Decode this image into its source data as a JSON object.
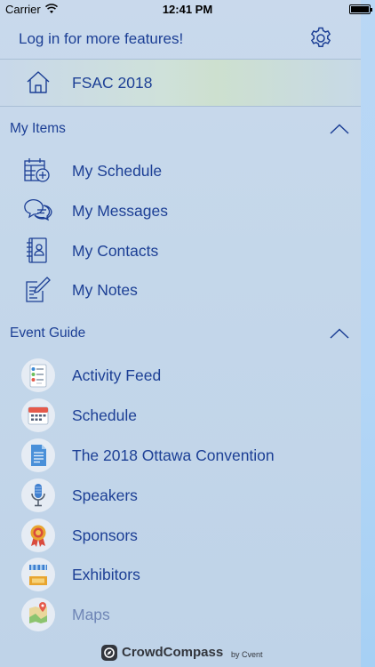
{
  "status_bar": {
    "carrier": "Carrier",
    "time": "12:41 PM"
  },
  "header": {
    "login_text": "Log in for more features!",
    "settings_icon": "gear-icon"
  },
  "home": {
    "label": "FSAC 2018",
    "icon": "home-icon"
  },
  "my_items": {
    "title": "My Items",
    "items": [
      {
        "label": "My Schedule",
        "icon": "calendar-add-icon"
      },
      {
        "label": "My Messages",
        "icon": "chat-bubbles-icon"
      },
      {
        "label": "My Contacts",
        "icon": "contacts-book-icon"
      },
      {
        "label": "My Notes",
        "icon": "note-pencil-icon"
      }
    ]
  },
  "event_guide": {
    "title": "Event Guide",
    "items": [
      {
        "label": "Activity Feed",
        "icon": "activity-feed-icon"
      },
      {
        "label": "Schedule",
        "icon": "calendar-icon"
      },
      {
        "label": "The 2018 Ottawa Convention",
        "icon": "document-icon"
      },
      {
        "label": "Speakers",
        "icon": "microphone-icon"
      },
      {
        "label": "Sponsors",
        "icon": "ribbon-award-icon"
      },
      {
        "label": "Exhibitors",
        "icon": "booth-icon"
      },
      {
        "label": "Maps",
        "icon": "map-icon"
      }
    ]
  },
  "footer": {
    "brand": "CrowdCompass",
    "by": "by Cvent"
  },
  "colors": {
    "text": "#1c3f95",
    "background": "#c9d9ec",
    "divider": "#a9bfd6"
  }
}
